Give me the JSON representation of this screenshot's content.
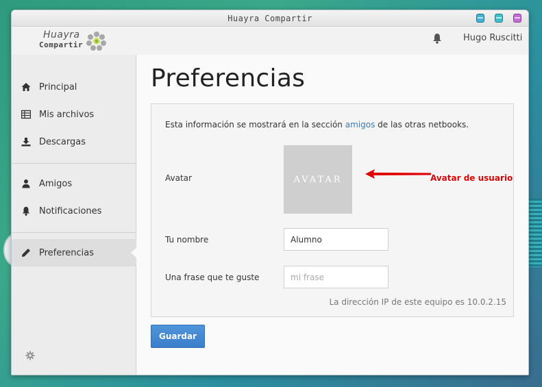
{
  "window": {
    "title": "Huayra Compartir",
    "buttons": [
      {
        "name": "minimize",
        "color": "#3fb3d4"
      },
      {
        "name": "maximize",
        "color": "#3fc0c8"
      },
      {
        "name": "close",
        "color": "#c66bd8"
      }
    ]
  },
  "header": {
    "logo_line1": "Huayra",
    "logo_line2": "Compartir",
    "user_name": "Hugo Ruscitti",
    "notification_icon": "bell-icon"
  },
  "sidebar": {
    "items": [
      {
        "label": "Principal",
        "icon": "home-icon"
      },
      {
        "label": "Mis archivos",
        "icon": "table-icon"
      },
      {
        "label": "Descargas",
        "icon": "download-icon"
      },
      {
        "label": "Amigos",
        "icon": "user-icon"
      },
      {
        "label": "Notificaciones",
        "icon": "bell-icon"
      },
      {
        "label": "Preferencias",
        "icon": "pencil-icon",
        "active": true
      }
    ],
    "settings_icon": "gear-icon"
  },
  "main": {
    "title": "Preferencias",
    "info_prefix": "Esta información se mostrará en la sección ",
    "info_link": "amigos",
    "info_suffix": " de las otras netbooks.",
    "avatar_label": "Avatar",
    "avatar_placeholder": "AVATAR",
    "annotation": "Avatar de usuario",
    "name_label": "Tu nombre",
    "name_value": "Alumno",
    "phrase_label": "Una frase que te guste",
    "phrase_placeholder": "mi frase",
    "ip_text": "La dirección IP de este equipo es 10.0.2.15",
    "save_label": "Guardar"
  },
  "colors": {
    "accent": "#3b7fcb",
    "link": "#3a7ab8",
    "annotation": "#e00000"
  }
}
